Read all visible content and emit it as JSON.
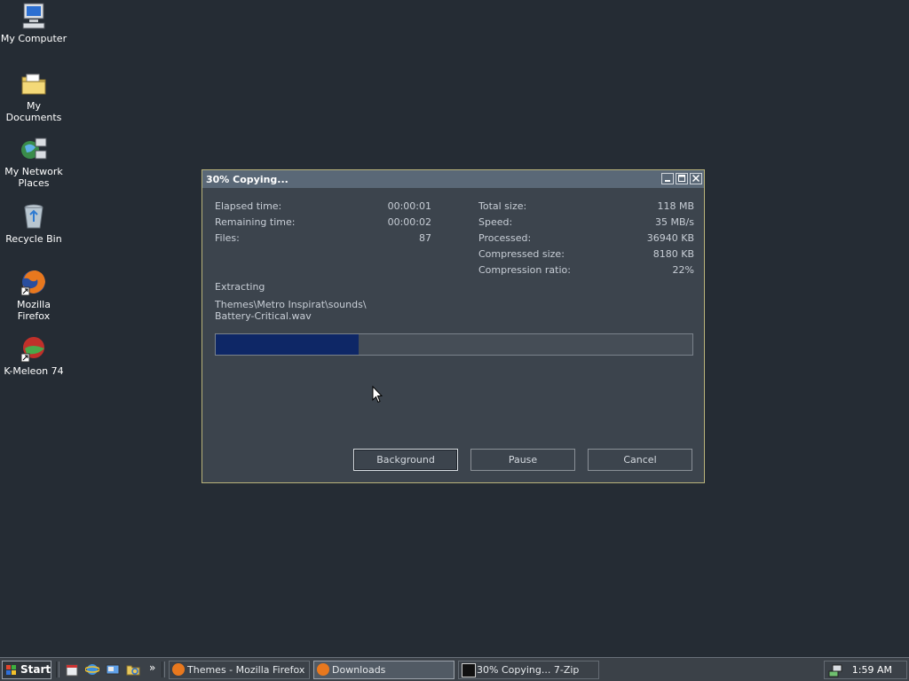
{
  "desktop": {
    "icons": [
      {
        "label": "My Computer"
      },
      {
        "label": "My Documents"
      },
      {
        "label": "My Network Places"
      },
      {
        "label": "Recycle Bin"
      },
      {
        "label": "Mozilla Firefox"
      },
      {
        "label": "K-Meleon 74"
      }
    ]
  },
  "dialog": {
    "title": "30% Copying...",
    "left_stats": [
      {
        "label": "Elapsed time:",
        "value": "00:00:01"
      },
      {
        "label": "Remaining time:",
        "value": "00:00:02"
      },
      {
        "label": "Files:",
        "value": "87"
      }
    ],
    "right_stats": [
      {
        "label": "Total size:",
        "value": "118 MB"
      },
      {
        "label": "Speed:",
        "value": "35 MB/s"
      },
      {
        "label": "Processed:",
        "value": "36940 KB"
      },
      {
        "label": "Compressed size:",
        "value": "8180 KB"
      },
      {
        "label": "Compression ratio:",
        "value": "22%"
      }
    ],
    "operation": "Extracting",
    "path_line1": "Themes\\Metro Inspirat\\sounds\\",
    "path_line2": "Battery-Critical.wav",
    "progress_percent": 30,
    "progress_color": "#0e2766",
    "buttons": {
      "background": "Background",
      "pause": "Pause",
      "cancel": "Cancel"
    }
  },
  "taskbar": {
    "start_label": "Start",
    "quick_launch": [
      "calendar-icon",
      "internet-explorer-icon",
      "show-desktop-icon",
      "explorer-icon"
    ],
    "overflow_glyph": "»",
    "tasks": [
      {
        "label": "Themes - Mozilla Firefox",
        "icon": "firefox-icon"
      },
      {
        "label": "Downloads",
        "icon": "firefox-icon"
      },
      {
        "label": "30% Copying... 7-Zip",
        "icon": "7zip-icon"
      }
    ],
    "clock": "1:59 AM"
  }
}
